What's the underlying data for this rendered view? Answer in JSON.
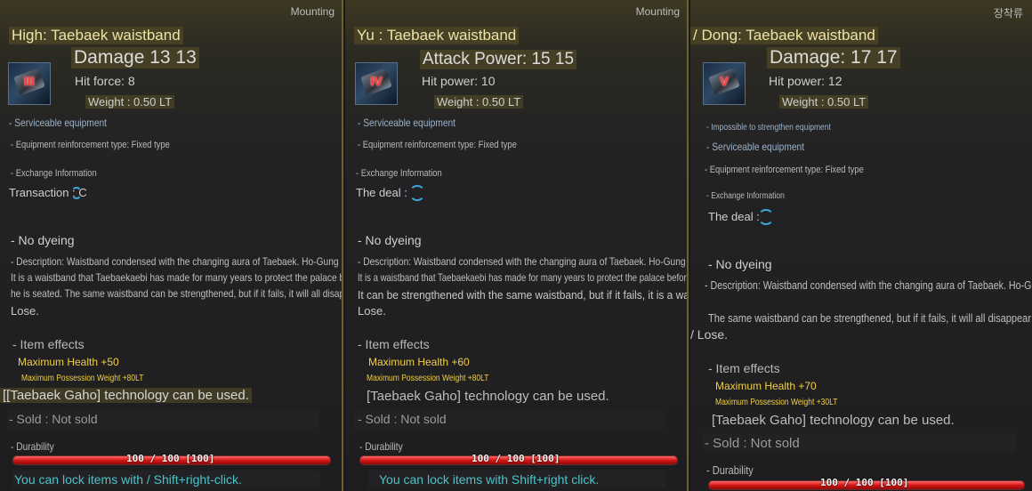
{
  "panels": [
    {
      "mounting": "Mounting",
      "title": "High: Taebaek waistband",
      "icon_roman": "III",
      "attack": "Damage 13 13",
      "hit": "Hit force: 8",
      "weight": "Weight : 0.50 LT",
      "notes": [
        "- Serviceable equipment"
      ],
      "reinforcement": "- Equipment reinforcement type: Fixed type",
      "exchange_title": "- Exchange Information",
      "transaction": "Transaction : C",
      "dyeing": "- No dyeing",
      "description": [
        "- Description: Waistband condensed with the changing aura of Taebaek. Ho-Gung master",
        "It is a waistband that Taebaekaebi has made for many years to protect the palace before",
        "he is seated. The same waistband can be strengthened, but if it fails, it will all disappear"
      ],
      "description_tail": "Lose.",
      "effects_title": "- Item effects",
      "effect_health": "Maximum Health +50",
      "effect_weight": "Maximum Possession Weight +80LT",
      "technology": "[[Taebaek Gaho] technology can be used.",
      "sold": "- Sold : Not sold",
      "durability_label": "- Durability",
      "durability_text": "100 / 100  [100]",
      "durability_value": 1.0,
      "lock_hint": "You can lock items with / Shift+right-click."
    },
    {
      "mounting": "Mounting",
      "title": "Yu : Taebaek waistband",
      "icon_roman": "IV",
      "attack": "Attack Power: 15 15",
      "hit": "Hit power: 10",
      "weight": "Weight : 0.50 LT",
      "notes": [
        "- Serviceable equipment"
      ],
      "reinforcement": "- Equipment reinforcement type: Fixed type",
      "exchange_title": "- Exchange Information",
      "transaction": "The deal :",
      "dyeing": "- No dyeing",
      "description": [
        "- Description: Waistband condensed with the changing aura of Taebaek. Ho-Gung master",
        "It is a waistband that Taebaekaebi has made for many years to protect the palace before he is seated."
      ],
      "description_wide": "It can be strengthened with the same waistband, but if it fails, it is a waistband made for many years by Taebaekkaebi to protect the palace before it all disappears.",
      "description_tail": "Lose.",
      "effects_title": "- Item effects",
      "effect_health": "Maximum Health +60",
      "effect_weight": "Maximum Possession Weight +80LT",
      "technology": "[Taebaek Gaho] technology can be used.",
      "sold": "- Sold : Not sold",
      "durability_label": "- Durability",
      "durability_text": "100 / 100  [100]",
      "durability_value": 1.0,
      "lock_hint": "You can lock items with Shift+right click."
    },
    {
      "mounting": "장착류",
      "title": "/ Dong: Taebaek waistband",
      "icon_roman": "V",
      "attack": "Damage: 17 17",
      "hit": "Hit power: 12",
      "weight": "Weight : 0.50 LT",
      "notes": [
        "- Impossible to strengthen equipment",
        "- Serviceable equipment"
      ],
      "reinforcement": "- Equipment reinforcement type: Fixed type",
      "exchange_title": "- Exchange Information",
      "transaction": "The deal :",
      "dyeing": "- No dyeing",
      "description": [
        "- Description: Waistband condensed with the changing aura of Taebaek. Ho-Gung master"
      ],
      "description_extra": "The same waistband can be strengthened, but if it fails, it will all disappear",
      "description_tail": "/ Lose.",
      "effects_title": "- Item effects",
      "effect_health": "Maximum Health +70",
      "effect_weight": "Maximum Possession Weight +30LT",
      "technology": "[Taebaek Gaho] technology can be used.",
      "sold": "- Sold : Not sold",
      "durability_label": "- Durability",
      "durability_text": "100 / 100  [100]",
      "durability_value": 1.0
    }
  ],
  "colors": {
    "title": "#efe2a6",
    "effect": "#f0cf4a",
    "hint": "#4bc3c8",
    "durability": "#d41616"
  }
}
